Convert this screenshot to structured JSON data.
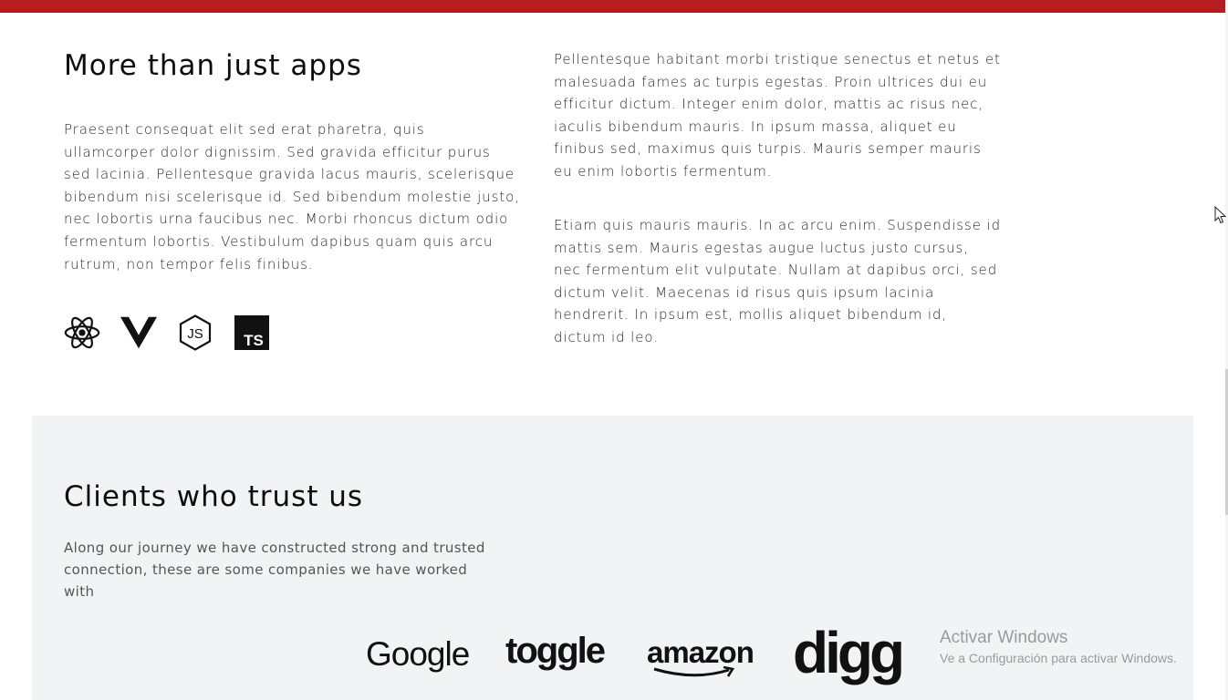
{
  "apps_section": {
    "title": "More than just apps",
    "intro": "Praesent consequat elit sed erat pharetra, quis ullamcorper dolor dignissim. Sed gravida efficitur purus sed lacinia. Pellentesque gravida lacus mauris, scelerisque bibendum nisi scelerisque id. Sed bibendum molestie justo, nec lobortis urna faucibus nec. Morbi rhoncus dictum odio fermentum lobortis. Vestibulum dapibus quam quis arcu rutrum, non tempor felis finibus.",
    "paragraph_1": "Pellentesque habitant morbi tristique senectus et netus et malesuada fames ac turpis egestas. Proin ultrices dui eu efficitur dictum. Integer enim dolor, mattis ac risus nec, iaculis bibendum mauris. In ipsum massa, aliquet eu finibus sed, maximus quis turpis. Mauris semper mauris eu enim lobortis fermentum.",
    "paragraph_2": "Etiam quis mauris mauris. In ac arcu enim. Suspendisse id mattis sem. Mauris egestas augue luctus justo cursus, nec fermentum elit vulputate. Nullam at dapibus orci, sed dictum velit. Maecenas id risus quis ipsum lacinia hendrerit. In ipsum est, mollis aliquet bibendum id, dictum id leo.",
    "tech_icons": [
      "react-icon",
      "vue-icon",
      "nodejs-icon",
      "typescript-icon"
    ],
    "typescript_label": "TS",
    "nodejs_label": "JS"
  },
  "clients_section": {
    "title": "Clients who trust us",
    "description": "Along our journey we have constructed strong and trusted connection, these are some companies we have worked with",
    "logos": [
      "Google",
      "toggle",
      "amazon",
      "digg"
    ]
  },
  "windows_watermark": {
    "title": "Activar Windows",
    "subtitle": "Ve a Configuración para activar Windows."
  },
  "colors": {
    "top_bar": "#b71c20",
    "clients_background": "#f2f3f5",
    "text_dark": "#111111",
    "watermark": "#9a9a9a"
  }
}
